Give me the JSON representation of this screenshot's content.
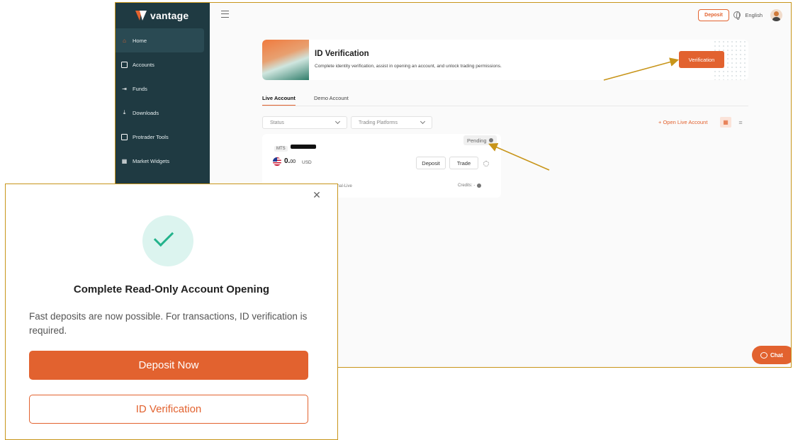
{
  "brand": {
    "name": "vantage",
    "accent_color": "#e2622f",
    "sidebar_color": "#1f3a42"
  },
  "sidebar": {
    "items": [
      {
        "label": "Home",
        "icon": "home-icon",
        "active": true
      },
      {
        "label": "Accounts",
        "icon": "accounts-icon"
      },
      {
        "label": "Funds",
        "icon": "funds-icon"
      },
      {
        "label": "Downloads",
        "icon": "download-icon"
      },
      {
        "label": "Protrader Tools",
        "icon": "toolbox-icon"
      },
      {
        "label": "Market Widgets",
        "icon": "widgets-icon"
      }
    ]
  },
  "topbar": {
    "deposit_label": "Deposit",
    "language": "English"
  },
  "banner": {
    "title": "ID Verification",
    "description": "Complete identity verification, assist in opening an account, and unlock trading permissions.",
    "button_label": "Verification"
  },
  "tabs": [
    {
      "label": "Live Account",
      "active": true
    },
    {
      "label": "Demo Account"
    }
  ],
  "filters": {
    "status": "Status",
    "platforms": "Trading Platforms"
  },
  "open_live_label": "+ Open Live Account",
  "account_card": {
    "status": "Pending",
    "platform": "MTS",
    "balance_int": "0.",
    "balance_dec": "00",
    "currency": "USD",
    "deposit_label": "Deposit",
    "trade_label": "Trade",
    "footer_left": "Standard STP    Vantage International-Live",
    "credits": "Credits: -"
  },
  "chat_label": "Chat",
  "modal": {
    "title": "Complete Read-Only Account Opening",
    "description": "Fast deposits are now possible. For transactions, ID verification is required.",
    "primary_button": "Deposit Now",
    "secondary_button": "ID Verification"
  },
  "annotation_color": "#c8951a"
}
